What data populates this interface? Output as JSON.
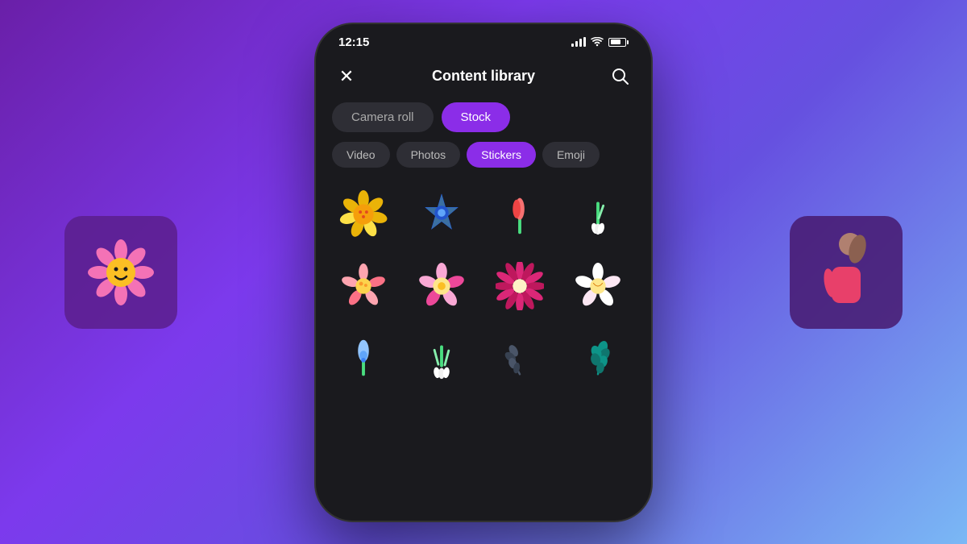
{
  "background": {
    "gradient_start": "#6a1fa8",
    "gradient_end": "#7dd3fc"
  },
  "left_card": {
    "emoji": "🌸",
    "description": "Pink flower with smiley face sticker"
  },
  "right_card": {
    "emoji": "🧍",
    "description": "Woman silhouette in pink top"
  },
  "status_bar": {
    "time": "12:15",
    "signal": "●●●●",
    "wifi": "wifi",
    "battery": "battery"
  },
  "header": {
    "close_icon": "×",
    "title": "Content library",
    "search_icon": "🔍"
  },
  "tabs_row1": [
    {
      "label": "Camera roll",
      "active": false
    },
    {
      "label": "Stock",
      "active": true
    }
  ],
  "tabs_row2": [
    {
      "label": "Video",
      "active": false
    },
    {
      "label": "Photos",
      "active": false
    },
    {
      "label": "Stickers",
      "active": true
    },
    {
      "label": "Emoji",
      "active": false
    }
  ],
  "stickers": [
    {
      "emoji": "🌼",
      "description": "Yellow flower sticker"
    },
    {
      "emoji": "✻",
      "description": "Blue star flower sticker"
    },
    {
      "emoji": "🌷",
      "description": "Pink tulip bud sticker"
    },
    {
      "emoji": "❄",
      "description": "Snowdrop flower sticker"
    },
    {
      "emoji": "🌸",
      "description": "Light pink flower sticker"
    },
    {
      "emoji": "🌸",
      "description": "Pink five-petal flower sticker"
    },
    {
      "emoji": "🌺",
      "description": "Magenta daisy sticker"
    },
    {
      "emoji": "✿",
      "description": "White cherry blossom sticker"
    },
    {
      "emoji": "🪻",
      "description": "Blue bell flower sticker"
    },
    {
      "emoji": "🌿",
      "description": "Snowdrop trio sticker"
    },
    {
      "emoji": "🍃",
      "description": "Dark olive leaf branch sticker"
    },
    {
      "emoji": "🌿",
      "description": "Teal herb sticker"
    }
  ]
}
